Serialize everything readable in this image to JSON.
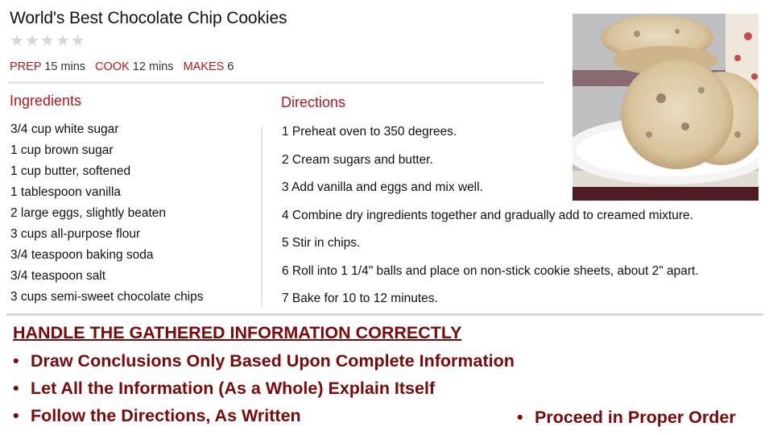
{
  "recipe": {
    "title": "World's Best Chocolate Chip Cookies",
    "rating": {
      "value": 0,
      "max": 5,
      "icon": "star-icon"
    },
    "meta": [
      {
        "key": "PREP",
        "value": "15 mins"
      },
      {
        "key": "COOK",
        "value": "12 mins"
      },
      {
        "key": "MAKES",
        "value": "6"
      }
    ],
    "ingredients_heading": "Ingredients",
    "ingredients": [
      "3/4 cup white sugar",
      "1 cup brown sugar",
      "1 cup butter, softened",
      "1 tablespoon vanilla",
      "2 large eggs, slightly beaten",
      "3 cups all-purpose flour",
      "3/4 teaspoon baking soda",
      "3/4 teaspoon salt",
      "3 cups semi-sweet chocolate chips"
    ],
    "directions_heading": "Directions",
    "directions": [
      "1 Preheat oven to 350 degrees.",
      "2 Cream sugars and butter.",
      "3 Add vanilla and eggs and mix well.",
      "4 Combine dry ingredients together and gradually add to creamed mixture.",
      "5 Stir in chips.",
      "6 Roll into 1 1/4\" balls and place on non-stick cookie sheets, about 2\" apart.",
      "7 Bake for 10 to 12 minutes."
    ],
    "photo": {
      "description": "Stack of chocolate chip cookies on a white plate with a polka-dot cup"
    }
  },
  "colors": {
    "accent_red": "#c0161e",
    "callout_maroon": "#7a0a0a"
  },
  "callout": {
    "heading": "HANDLE THE GATHERED INFORMATION CORRECTLY",
    "bullet_glyph": "•",
    "bullets": [
      "Draw Conclusions Only Based Upon Complete Information",
      "Let All the Information (As a Whole) Explain Itself",
      "Follow the Directions, As Written",
      "Proceed in Proper Order"
    ]
  }
}
